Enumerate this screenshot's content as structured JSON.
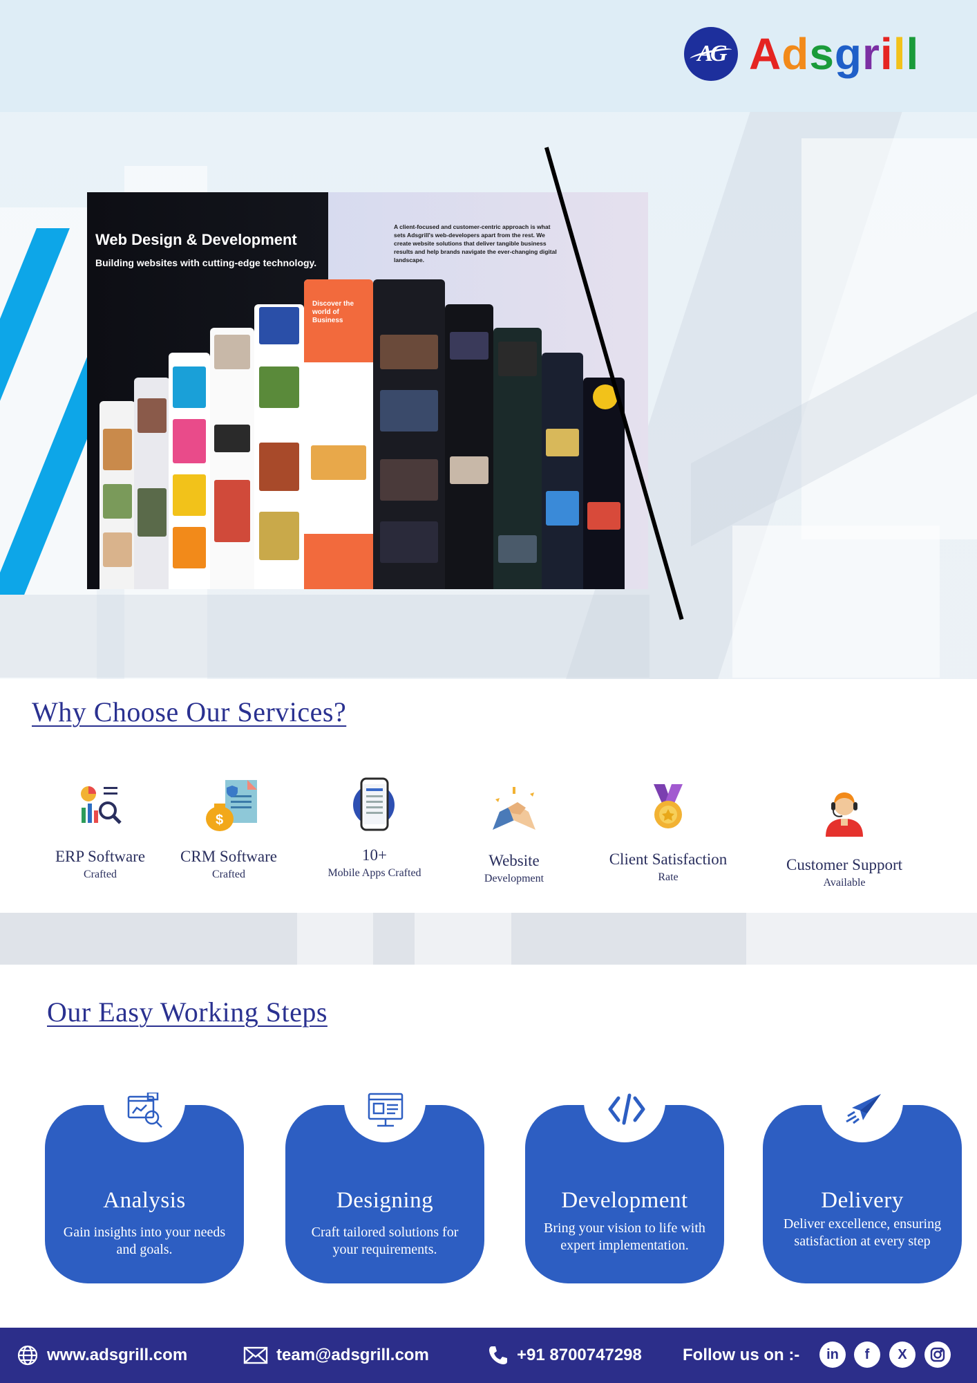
{
  "brand": {
    "logo_mark": "AG",
    "name_letters": [
      "A",
      "d",
      "s",
      "g",
      "r",
      "i",
      "l",
      "l"
    ]
  },
  "hero": {
    "title": "Web Design & Development",
    "subtitle": "Building websites with cutting-edge technology.",
    "description": "A client-focused and customer-centric approach is what sets Adsgrill's web-developers apart from the rest. We create website solutions that deliver tangible business results and help brands navigate the ever-changing digital landscape.",
    "mock_headline": "Discover the world of Business",
    "colors": {
      "accent_stripe": "#0da6e8",
      "mock_orange": "#f26a3d"
    }
  },
  "why": {
    "title": "Why Choose Our Services?",
    "features": [
      {
        "icon": "analytics-icon",
        "title": "ERP Software",
        "sub": "Crafted"
      },
      {
        "icon": "crm-document-icon",
        "title": "CRM Software",
        "sub": "Crafted"
      },
      {
        "icon": "smartphone-icon",
        "title": "10+",
        "sub": "Mobile Apps Crafted"
      },
      {
        "icon": "handshake-icon",
        "title": "Website",
        "sub": "Development"
      },
      {
        "icon": "medal-icon",
        "title": "Client Satisfaction",
        "sub": "Rate"
      },
      {
        "icon": "support-agent-icon",
        "title": "Customer Support",
        "sub": "Available"
      }
    ]
  },
  "steps": {
    "title": "Our Easy Working Steps",
    "items": [
      {
        "icon": "analysis-icon",
        "title": "Analysis",
        "desc": "Gain insights into your needs and goals."
      },
      {
        "icon": "design-icon",
        "title": "Designing",
        "desc": "Craft tailored solutions for your requirements."
      },
      {
        "icon": "code-icon",
        "title": "Development",
        "desc": "Bring your vision to life with expert implementation."
      },
      {
        "icon": "paper-plane-icon",
        "title": "Delivery",
        "desc": "Deliver excellence, ensuring satisfaction at every step"
      }
    ],
    "colors": {
      "card": "#2d5ec2"
    }
  },
  "footer": {
    "website": "www.adsgrill.com",
    "email": "team@adsgrill.com",
    "phone": "+91 8700747298",
    "follow_label": "Follow us on :-",
    "socials": [
      "linkedin-icon",
      "facebook-icon",
      "x-icon",
      "instagram-icon"
    ],
    "colors": {
      "background": "#2c2e8a"
    }
  }
}
